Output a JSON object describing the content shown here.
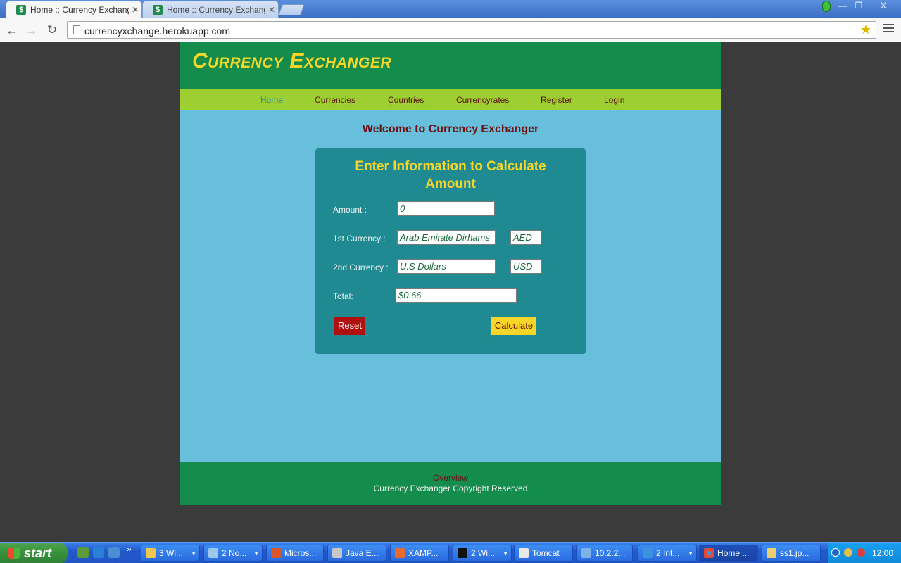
{
  "browser": {
    "tabs": [
      {
        "title": "Home :: Currency Exchanger",
        "favicon": "$",
        "active": true
      },
      {
        "title": "Home :: Currency Exchanger",
        "favicon": "$",
        "active": false
      }
    ],
    "url": "currencyxchange.herokuapp.com",
    "window_controls": {
      "minimize": "—",
      "maximize": "❐",
      "close": "X"
    }
  },
  "site": {
    "logo": "Currency Exchanger",
    "nav": [
      "Home",
      "Currencies",
      "Countries",
      "Currencyrates",
      "Register",
      "Login"
    ],
    "current_nav": "Home",
    "welcome": "Welcome to Currency Exchanger",
    "form": {
      "title_line1": "Enter Information to Calculate",
      "title_line2": "Amount",
      "amount_label": "Amount :",
      "amount_value": "0",
      "currency1_label": "1st Currency :",
      "currency1_name": "Arab Emirate Dirhams",
      "currency1_code": "AED",
      "currency2_label": "2nd Currency :",
      "currency2_name": "U.S Dollars",
      "currency2_code": "USD",
      "total_label": "Total:",
      "total_value": "$0.66",
      "reset_label": "Reset",
      "calculate_label": "Calculate"
    },
    "footer": {
      "link": "Overview",
      "copyright": "Currency Exchanger Copyright Reserved"
    }
  },
  "taskbar": {
    "start_label": "start",
    "items": [
      "3 Wi...",
      "2 No...",
      "Micros...",
      "Java E...",
      "XAMP...",
      "2 Wi...",
      "Tomcat",
      "10.2.2...",
      "2 Int...",
      "Home ...",
      "ss1.jp..."
    ],
    "clock": "12:00"
  },
  "colors": {
    "header_green": "#148c4c",
    "nav_lime": "#9ecf32",
    "page_blue": "#68bfdc",
    "box_teal": "#1f8a92",
    "accent_yellow": "#f6d628",
    "dark_red": "#6a1111",
    "reset_red": "#b01010"
  }
}
